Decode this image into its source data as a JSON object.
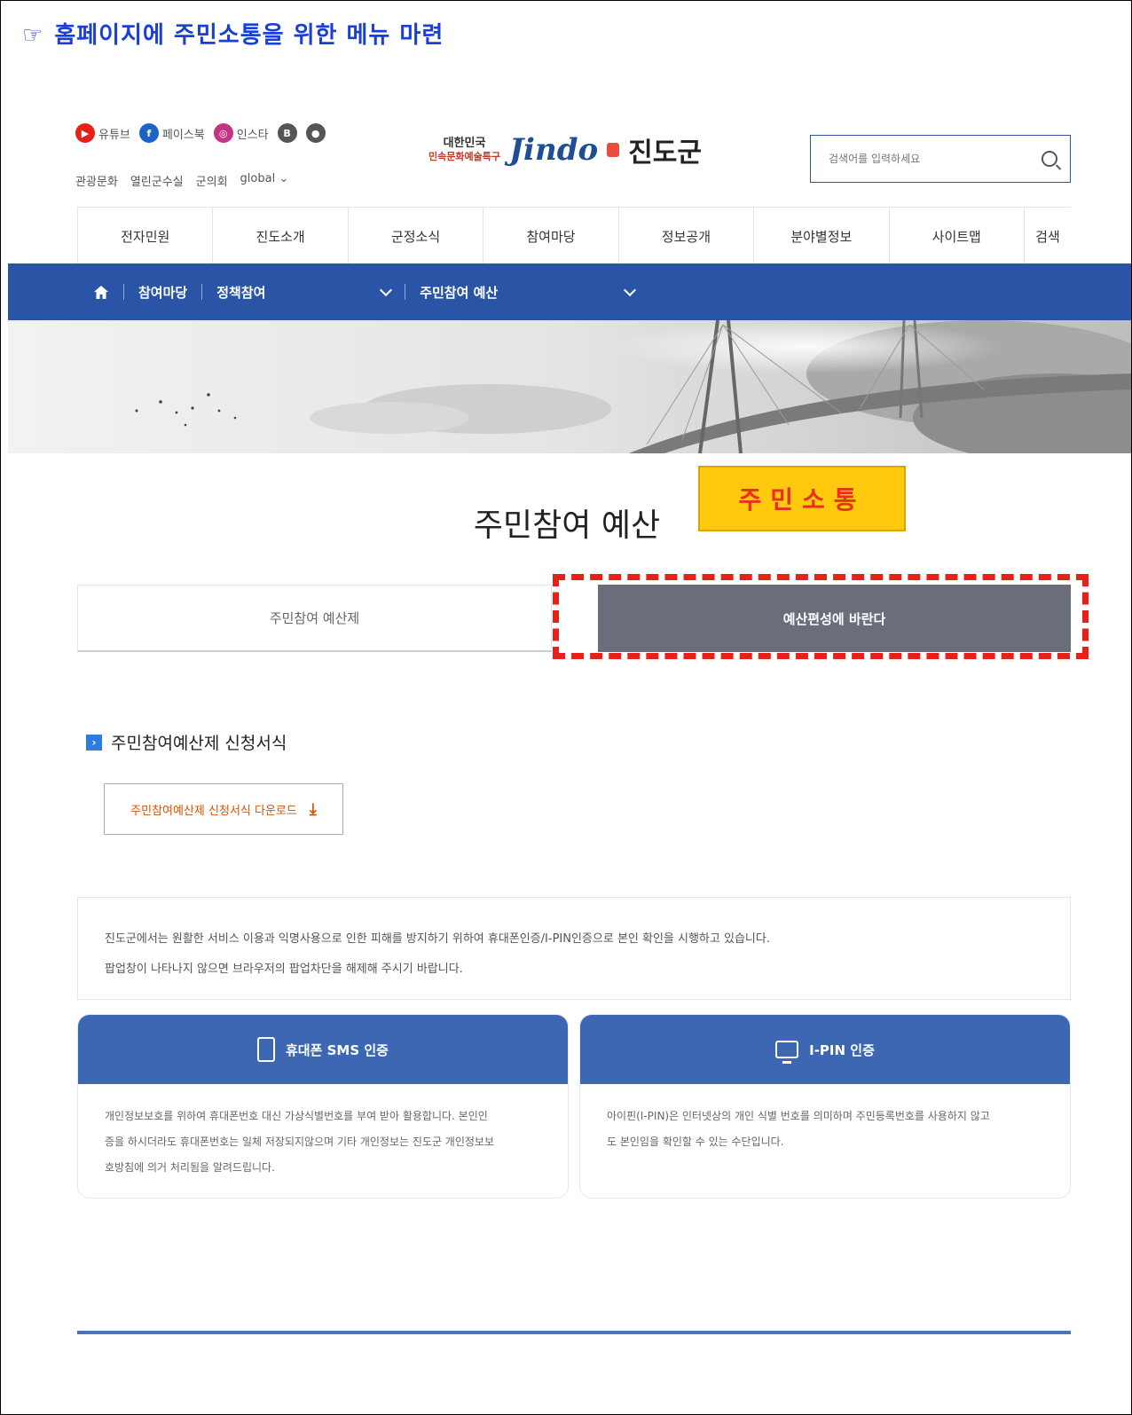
{
  "doc_title": {
    "hand_icon": "☞",
    "text": "홈페이지에 주민소통을 위한 메뉴 마련"
  },
  "header": {
    "sns": [
      {
        "label": "유튜브",
        "icon": "youtube-icon",
        "color": "#e62117"
      },
      {
        "label": "페이스북",
        "icon": "facebook-icon",
        "color": "#1d62c9"
      },
      {
        "label": "인스타",
        "icon": "instagram-icon",
        "color": "#c13584"
      },
      {
        "label": "",
        "icon": "blog-icon",
        "color": "#555555"
      },
      {
        "label": "",
        "icon": "kakao-icon",
        "color": "#555555"
      }
    ],
    "util_links": [
      "관광문화",
      "열린군수실",
      "군의회",
      "global"
    ],
    "logo": {
      "slogan_line1": "대한민국",
      "slogan_line2": "민속문화예술특구",
      "english": "Jindo",
      "korean": "진도군"
    },
    "search": {
      "placeholder": "검색어를 입력하세요"
    }
  },
  "gnb": [
    "전자민원",
    "진도소개",
    "군정소식",
    "참여마당",
    "정보공개",
    "분야별정보",
    "사이트맵",
    "검색"
  ],
  "breadcrumb": {
    "level1": "참여마당",
    "level2": "정책참여",
    "level3": "주민참여 예산"
  },
  "page": {
    "heading": "주민참여 예산",
    "callout": "주민소통",
    "tabs": [
      {
        "label": "주민참여 예산제",
        "active": false
      },
      {
        "label": "예산편성에 바란다",
        "active": true
      }
    ],
    "section_title": "주민참여예산제 신청서식",
    "download_label": "주민참여예산제 신청서식 다운로드",
    "notice_lines": [
      "진도군에서는 원활한 서비스 이용과 익명사용으로 인한 피해를 방지하기 위하여 휴대폰인증/I-PIN인증으로 본인 확인을 시행하고 있습니다.",
      "팝업창이 나타나지 않으면 브라우저의 팝업차단을 해제해 주시기 바랍니다."
    ],
    "cards": [
      {
        "title": "휴대폰 SMS 인증",
        "lines": [
          "개인정보보호를 위하여 휴대폰번호 대신 가상식별번호를 부여 받아 활용합니다. 본인인",
          "증을 하시더라도 휴대폰번호는 일체 저장되지않으며 기타 개인정보는 진도군 개인정보보",
          "호방침에 의거 처리됨을 알려드립니다."
        ]
      },
      {
        "title": "I-PIN 인증",
        "lines": [
          "아이핀(I-PIN)은 인터넷상의 개인 식별 번호를 의미하며 주민등록번호를 사용하지 않고",
          "도 본인임을 확인할 수 있는 수단입니다."
        ]
      }
    ]
  },
  "colors": {
    "title_blue": "#1a3fd8",
    "nav_blue": "#2a54a6",
    "card_blue": "#3d67b2",
    "active_tab": "#6a6e7a",
    "callout_yellow": "#ffc90e",
    "callout_red": "#e8301c",
    "dash_red": "#e8201a"
  }
}
